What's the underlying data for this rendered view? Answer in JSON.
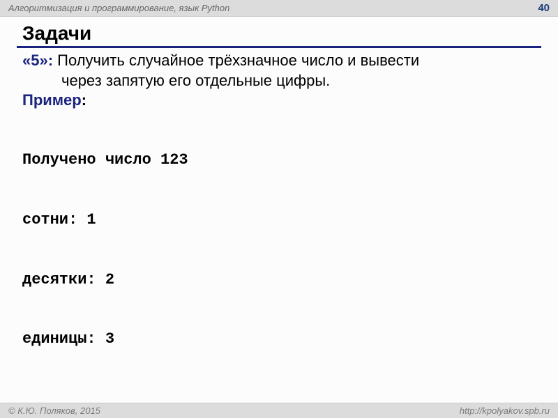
{
  "header": {
    "subject": "Алгоритмизация и программирование, язык Python",
    "page_number": "40"
  },
  "slide": {
    "title": "Задачи",
    "grade_label": "«5»:",
    "task_line1": " Получить случайное трёхзначное число и вывести",
    "task_line2": "через запятую его отдельные цифры.",
    "example_label": "Пример",
    "example_colon": ":",
    "output": {
      "line1": "Получено число 123",
      "line2": "сотни: 1",
      "line3": "десятки: 2",
      "line4": "единицы: 3"
    }
  },
  "footer": {
    "copyright": "© К.Ю. Поляков, 2015",
    "url": "http://kpolyakov.spb.ru"
  }
}
